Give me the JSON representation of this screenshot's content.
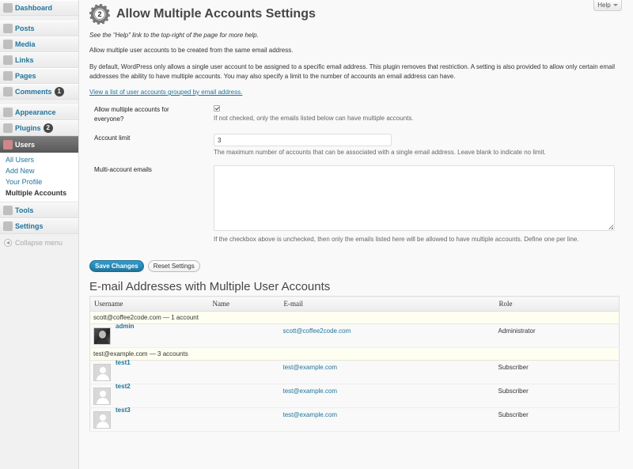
{
  "sidebar": {
    "items_top": [
      {
        "label": "Dashboard",
        "icon": "dashboard-icon"
      }
    ],
    "items_mid": [
      {
        "label": "Posts",
        "icon": "pin-icon"
      },
      {
        "label": "Media",
        "icon": "media-icon"
      },
      {
        "label": "Links",
        "icon": "link-icon"
      },
      {
        "label": "Pages",
        "icon": "page-icon"
      },
      {
        "label": "Comments",
        "icon": "comment-icon",
        "badge": "1"
      }
    ],
    "items_low": [
      {
        "label": "Appearance",
        "icon": "appearance-icon"
      },
      {
        "label": "Plugins",
        "icon": "plugin-icon",
        "badge": "2"
      },
      {
        "label": "Users",
        "icon": "users-icon"
      }
    ],
    "submenu": [
      "All Users",
      "Add New",
      "Your Profile",
      "Multiple Accounts"
    ],
    "items_bottom": [
      {
        "label": "Tools",
        "icon": "tools-icon"
      },
      {
        "label": "Settings",
        "icon": "settings-icon"
      }
    ],
    "collapse_label": "Collapse menu"
  },
  "help": {
    "label": "Help"
  },
  "page": {
    "icon_number": "2",
    "title": "Allow Multiple Accounts Settings",
    "help_hint": "See the \"Help\" link to the top-right of the page for more help.",
    "para1": "Allow multiple user accounts to be created from the same email address.",
    "para2": "By default, WordPress only allows a single user account to be assigned to a specific email address. This plugin removes that restriction. A setting is also provided to allow only certain email addresses the ability to have multiple accounts. You may also specify a limit to the number of accounts an email address can have.",
    "view_link": "View a list of user accounts grouped by email address."
  },
  "settings": {
    "allow_label": "Allow multiple accounts for everyone?",
    "allow_checked": true,
    "allow_desc": "If not checked, only the emails listed below can have multiple accounts.",
    "limit_label": "Account limit",
    "limit_value": "3",
    "limit_desc": "The maximum number of accounts that can be associated with a single email address. Leave blank to indicate no limit.",
    "emails_label": "Multi-account emails",
    "emails_value": "",
    "emails_desc": "If the checkbox above is unchecked, then only the emails listed here will be allowed to have multiple accounts. Define one per line."
  },
  "buttons": {
    "save": "Save Changes",
    "reset": "Reset Settings"
  },
  "table": {
    "heading": "E-mail Addresses with Multiple User Accounts",
    "columns": [
      "Username",
      "Name",
      "E-mail",
      "Role"
    ],
    "groups": [
      {
        "label": "scott@coffee2code.com — 1 account",
        "users": [
          {
            "username": "admin",
            "name": "",
            "email": "scott@coffee2code.com",
            "role": "Administrator",
            "avatar": "photo"
          }
        ]
      },
      {
        "label": "test@example.com — 3 accounts",
        "users": [
          {
            "username": "test1",
            "name": "",
            "email": "test@example.com",
            "role": "Subscriber",
            "avatar": "generic"
          },
          {
            "username": "test2",
            "name": "",
            "email": "test@example.com",
            "role": "Subscriber",
            "avatar": "generic"
          },
          {
            "username": "test3",
            "name": "",
            "email": "test@example.com",
            "role": "Subscriber",
            "avatar": "generic"
          }
        ]
      }
    ]
  }
}
